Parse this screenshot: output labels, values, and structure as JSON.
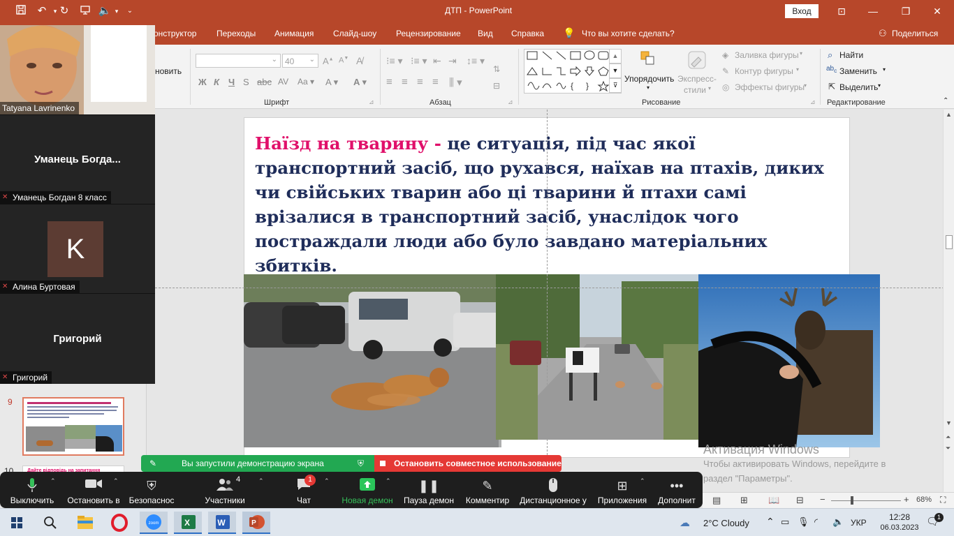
{
  "window": {
    "title": "ДТП  -  PowerPoint",
    "signin": "Вход"
  },
  "ribbon": {
    "tabs": [
      "онструктор",
      "Переходы",
      "Анимация",
      "Слайд-шоу",
      "Рецензирование",
      "Вид",
      "Справка"
    ],
    "tell_me": "Что вы хотите сделать?",
    "share": "Поделиться",
    "groups": {
      "font": "Шрифт",
      "paragraph": "Абзац",
      "drawing": "Рисование",
      "editing": "Редактирование"
    },
    "font_size": "40",
    "partial_left": "новить",
    "arrange": "Упорядочить",
    "quick_styles": [
      "Экспресс-",
      "стили"
    ],
    "shape_fill": "Заливка фигуры",
    "shape_outline": "Контур фигуры",
    "shape_effects": "Эффекты фигуры",
    "find": "Найти",
    "replace": "Заменить",
    "select": "Выделить"
  },
  "slide": {
    "highlight": "Наїзд на тварину - ",
    "body": "це ситуація, під час якої транспортний засіб, що рухався, наїхав на птахів, диких чи свійських тварин або ці тварини й птахи самі врізалися в транспортний засіб, унаслідок чого постраждали люди або було завдано матеріальних збитків."
  },
  "thumbnails": {
    "slide9_number": "9",
    "slide10_number": "10",
    "slide10_text": "Дайте відповідь на запитання"
  },
  "video": {
    "tiles": [
      {
        "label": "Tatyana Lavrinenko"
      },
      {
        "name": "Уманець  Богда...",
        "label": "Уманець Богдан 8 класс"
      },
      {
        "avatar_letter": "K",
        "label": "Алина Буртовая"
      },
      {
        "name": "Григорий",
        "label": "Григорий"
      }
    ]
  },
  "share_banner": {
    "started": "Вы запустили демонстрацию экрана",
    "stop": "Остановить совместное использование"
  },
  "zoom_toolbar": {
    "items": [
      {
        "label": "Выключить"
      },
      {
        "label": "Остановить в"
      },
      {
        "label": "Безопаснос"
      },
      {
        "label": "Участники",
        "count": "4"
      },
      {
        "label": "Чат",
        "badge": "1"
      },
      {
        "label": "Новая демон"
      },
      {
        "label": "Пауза демон"
      },
      {
        "label": "Комментир"
      },
      {
        "label": "Дистанционное у"
      },
      {
        "label": "Приложения"
      },
      {
        "label": "Дополнит"
      }
    ]
  },
  "ppt_status": {
    "zoom": "68%"
  },
  "activation": {
    "title": "Активация Windows",
    "line1": "Чтобы активировать Windows, перейдите в",
    "line2": "раздел \"Параметры\"."
  },
  "taskbar": {
    "weather": "2°C  Cloudy",
    "lang": "УКР",
    "time": "12:28",
    "date": "06.03.2023"
  },
  "colors": {
    "ppt_accent": "#b7472a",
    "slide_highlight": "#e0106a",
    "slide_text": "#1f2d5a",
    "zoom_green": "#22a852",
    "zoom_red": "#e53935"
  }
}
